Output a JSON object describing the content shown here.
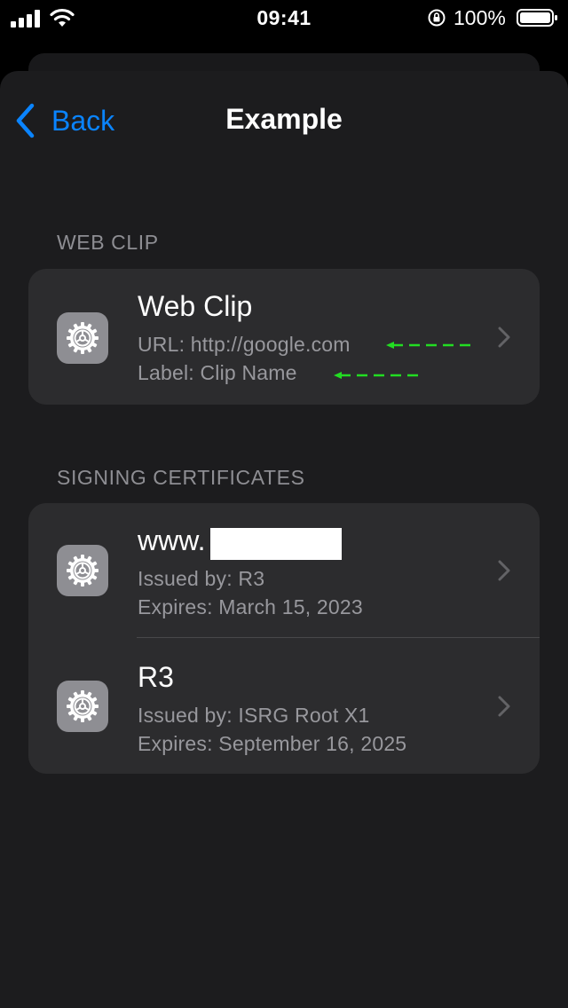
{
  "status_bar": {
    "time": "09:41",
    "battery_percent": "100%",
    "icons": [
      "signal-icon",
      "wifi-icon",
      "rotation-lock-icon",
      "battery-icon"
    ]
  },
  "nav": {
    "back_label": "Back",
    "title": "Example"
  },
  "sections": {
    "web_clip": {
      "header": "WEB CLIP",
      "row": {
        "title": "Web Clip",
        "url": "URL: http://google.com",
        "label": "Label: Clip Name"
      }
    },
    "certs": {
      "header": "SIGNING CERTIFICATES",
      "rows": [
        {
          "title": "www.",
          "issued": "Issued by: R3",
          "expires": "Expires: March 15, 2023"
        },
        {
          "title": "R3",
          "issued": "Issued by: ISRG Root X1",
          "expires": "Expires: September 16, 2025"
        }
      ]
    }
  },
  "colors": {
    "accent": "#0a84ff",
    "background": "#1c1c1e",
    "card": "#2c2c2e",
    "annotation_arrow": "#22dd22"
  }
}
